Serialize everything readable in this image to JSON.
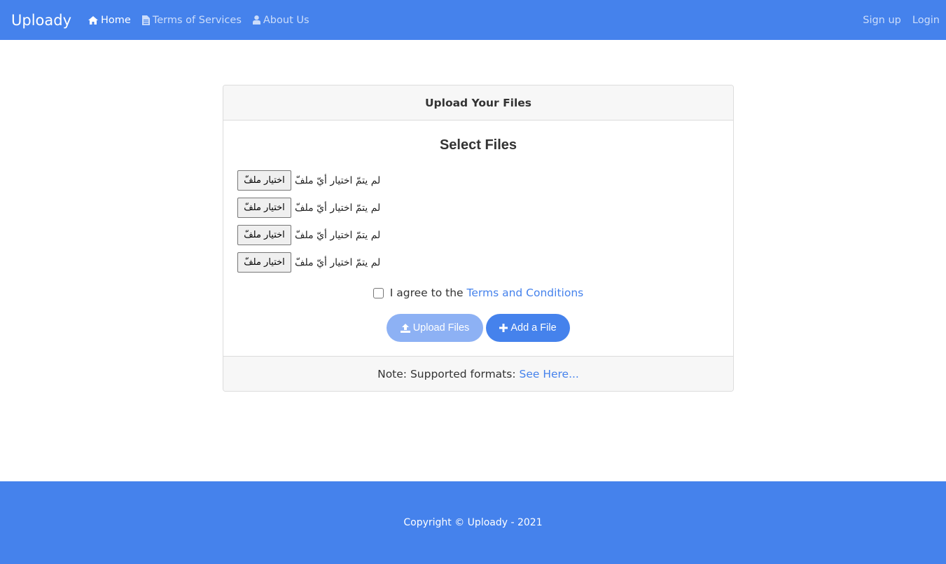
{
  "navbar": {
    "brand": "Uploady",
    "links": [
      {
        "label": "Home",
        "icon": "home-icon"
      },
      {
        "label": "Terms of Services",
        "icon": "file-text-icon"
      },
      {
        "label": "About Us",
        "icon": "user-icon"
      }
    ],
    "right": [
      {
        "label": "Sign up"
      },
      {
        "label": "Login"
      }
    ]
  },
  "card": {
    "header": "Upload Your Files",
    "title": "Select Files",
    "file_inputs": [
      {
        "button": "اختيار ملفّ",
        "status": "لم يتمّ اختيار أيّ ملفّ"
      },
      {
        "button": "اختيار ملفّ",
        "status": "لم يتمّ اختيار أيّ ملفّ"
      },
      {
        "button": "اختيار ملفّ",
        "status": "لم يتمّ اختيار أيّ ملفّ"
      },
      {
        "button": "اختيار ملفّ",
        "status": "لم يتمّ اختيار أيّ ملفّ"
      }
    ],
    "agree_text": "I agree to the",
    "agree_link": "Terms and Conditions",
    "upload_button": "Upload Files",
    "add_button": "Add a File",
    "note_text": "Note: Supported formats:",
    "note_link": "See Here..."
  },
  "footer": {
    "copyright": "Copyright © Uploady - 2021"
  },
  "colors": {
    "primary": "#4582ec",
    "primary_disabled": "#8db1f4",
    "card_header_bg": "#f7f7f7"
  }
}
